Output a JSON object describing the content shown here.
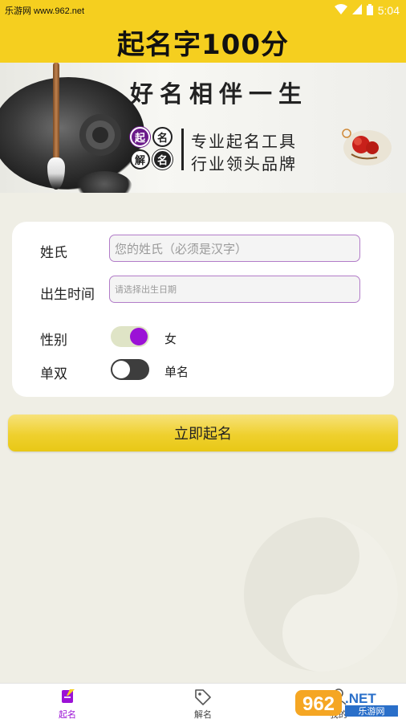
{
  "status_bar": {
    "site_watermark": "乐游网 www.962.net",
    "time": "5:04"
  },
  "header": {
    "title": "起名字100分"
  },
  "banner": {
    "slogan": "好名相伴一生",
    "seals": [
      "起",
      "名",
      "解",
      "名"
    ],
    "line1": "专业起名工具",
    "line2": "行业领头品牌"
  },
  "form": {
    "surname": {
      "label": "姓氏",
      "value": "",
      "placeholder": "您的姓氏（必须是汉字）"
    },
    "birth_time": {
      "label": "出生时间",
      "value": "",
      "placeholder": "请选择出生日期"
    },
    "gender": {
      "label": "性别",
      "on": true,
      "value_text": "女"
    },
    "single_double": {
      "label": "单双",
      "on": false,
      "value_text": "单名"
    }
  },
  "submit_label": "立即起名",
  "bottom_nav": [
    {
      "label": "起名",
      "icon": "edit-icon",
      "active": true
    },
    {
      "label": "解名",
      "icon": "tag-icon",
      "active": false
    },
    {
      "label": "我的",
      "icon": "user-icon",
      "active": false
    }
  ],
  "watermark_logo": {
    "number": "962",
    "net": ".NET",
    "site": "乐游网"
  },
  "colors": {
    "accent_yellow": "#f5cf1f",
    "accent_purple": "#9b12d6",
    "page_background": "#efeee5"
  }
}
